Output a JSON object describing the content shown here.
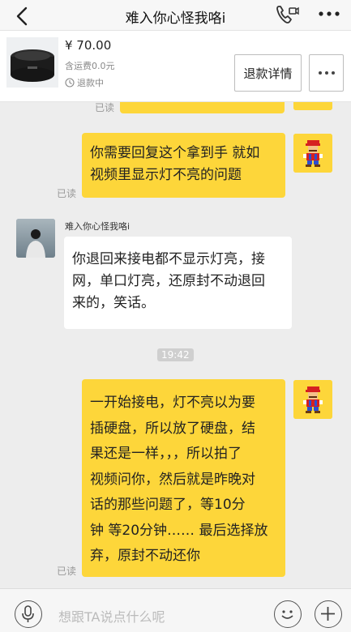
{
  "header": {
    "title": "难入你心怪我咯i"
  },
  "order": {
    "price": "¥ 70.00",
    "shipping": "含运费0.0元",
    "status": "退款中",
    "refund_button": "退款详情"
  },
  "messages": {
    "top_read": "已读",
    "m1": {
      "lines": [
        "你需要回复这个拿到手 就如",
        "视频里显示灯不亮的问题"
      ],
      "read": "已读"
    },
    "m2": {
      "sender": "难入你心怪我咯i",
      "lines": [
        "你退回来接电都不显示灯亮，接",
        "网，单口灯亮，还原封不动退回",
        "来的，笑话。"
      ]
    },
    "time": "19:42",
    "m3": {
      "lines": [
        "一开始接电，灯不亮以为要",
        "插硬盘，所以放了硬盘，结",
        "果还是一样，，，所以拍了",
        "视频问你，然后就是昨晚对",
        "话的那些问题了，等10分",
        "钟 等20分钟…… 最后选择放",
        "弃，原封不动还你"
      ],
      "read": "已读"
    }
  },
  "input": {
    "placeholder": "想跟TA说点什么呢"
  },
  "colors": {
    "bubble_mine": "#fdd63a",
    "bubble_theirs": "#ffffff",
    "chat_bg": "#ededed"
  }
}
